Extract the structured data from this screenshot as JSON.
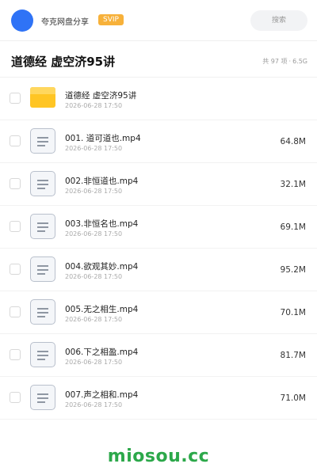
{
  "header": {
    "brand": "夸克网盘分享",
    "badge": "SVIP",
    "search_label": "搜索",
    "accent_color": "#2f73f6"
  },
  "folder": {
    "title": "道德经 虚空济95讲",
    "count_text": "共 97 项",
    "separator": "·",
    "size_text": "6.5G"
  },
  "files": [
    {
      "name": "道德经 虚空济95讲",
      "date": "2026-06-28 17:50",
      "size": "",
      "icon": "folder-icon"
    },
    {
      "name": "001. 道可道也.mp4",
      "date": "2026-06-28 17:50",
      "size": "64.8M",
      "icon": "video-file-icon"
    },
    {
      "name": "002.非恒道也.mp4",
      "date": "2026-06-28 17:50",
      "size": "32.1M",
      "icon": "video-file-icon"
    },
    {
      "name": "003.非恒名也.mp4",
      "date": "2026-06-28 17:50",
      "size": "69.1M",
      "icon": "video-file-icon"
    },
    {
      "name": "004.欲观其妙.mp4",
      "date": "2026-06-28 17:50",
      "size": "95.2M",
      "icon": "video-file-icon"
    },
    {
      "name": "005.无之相生.mp4",
      "date": "2026-06-28 17:50",
      "size": "70.1M",
      "icon": "video-file-icon"
    },
    {
      "name": "006.下之相盈.mp4",
      "date": "2026-06-28 17:50",
      "size": "81.7M",
      "icon": "video-file-icon"
    },
    {
      "name": "007.声之相和.mp4",
      "date": "2026-06-28 17:50",
      "size": "71.0M",
      "icon": "video-file-icon"
    }
  ],
  "footer": {
    "watermark": "miosou.cc",
    "watermark_color": "#2ca84a"
  }
}
